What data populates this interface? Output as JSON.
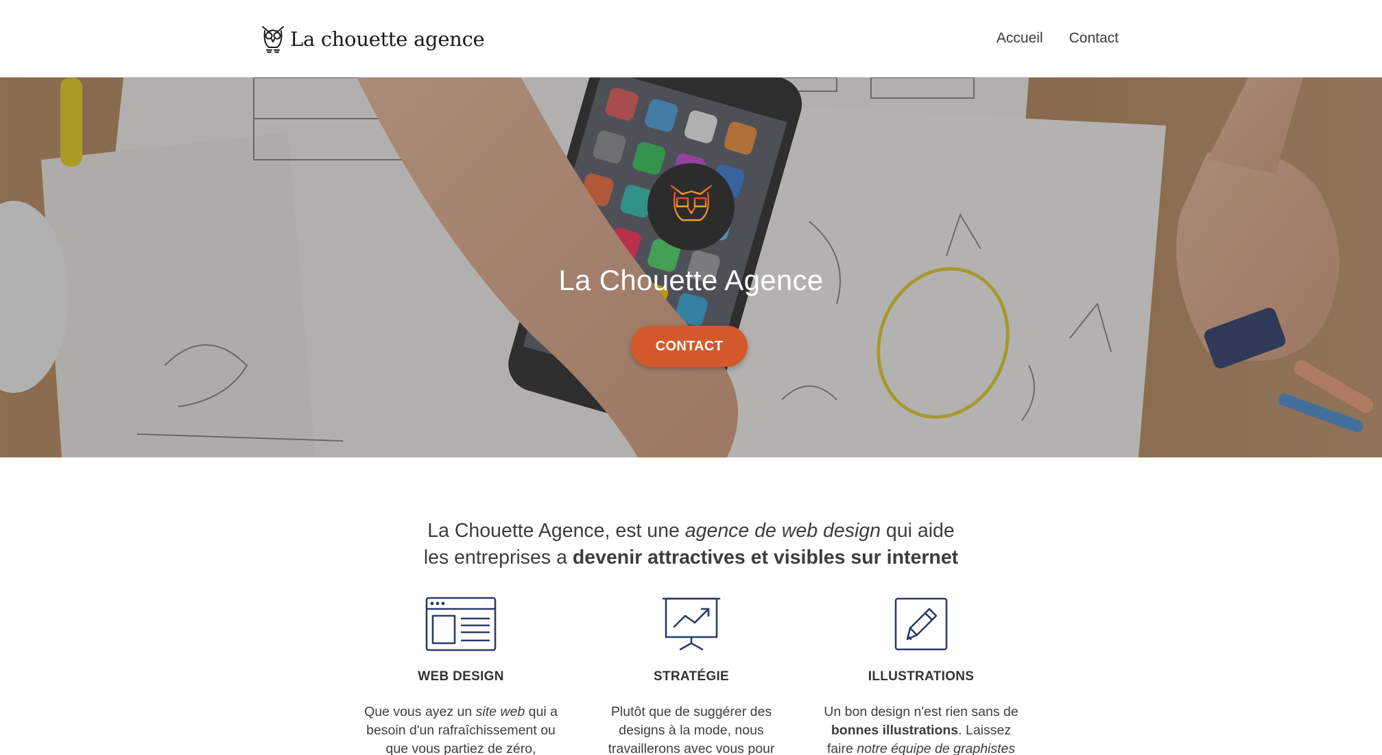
{
  "header": {
    "logo_text": "La chouette agence",
    "nav": [
      {
        "label": "Accueil"
      },
      {
        "label": "Contact"
      }
    ]
  },
  "hero": {
    "title": "La Chouette Agence",
    "cta_label": "CONTACT",
    "badge_icon": "owl-icon",
    "background": "photo-desk-phone-sketches"
  },
  "intro": {
    "part1": "La Chouette Agence, est une ",
    "part2_em": "agence de web design",
    "part3": " qui aide",
    "part4": "les entreprises a ",
    "part5_strong": "devenir attractives et visibles sur internet"
  },
  "services": [
    {
      "icon": "webpage-layout-icon",
      "title": "WEB DESIGN",
      "t1": "Que vous ayez un ",
      "t2_em": "site web",
      "t3": " qui a besoin d'un rafraîchissement ou que vous partiez de zéro, laissez-"
    },
    {
      "icon": "presentation-chart-icon",
      "title": "STRATÉGIE",
      "t1": "Plutôt que de suggérer des designs à la mode, nous travaillerons avec vous pour"
    },
    {
      "icon": "pencil-square-icon",
      "title": "ILLUSTRATIONS",
      "t1": "Un bon design n'est rien sans de ",
      "t2_strong": "bonnes illustrations",
      "t3": ". Laissez faire ",
      "t4_em": "notre équipe de graphistes"
    }
  ],
  "colors": {
    "accent": "#d4592a",
    "icon_stroke": "#2b3a6b",
    "badge_bg": "#2c2c2c",
    "text": "#3d3d3d"
  }
}
